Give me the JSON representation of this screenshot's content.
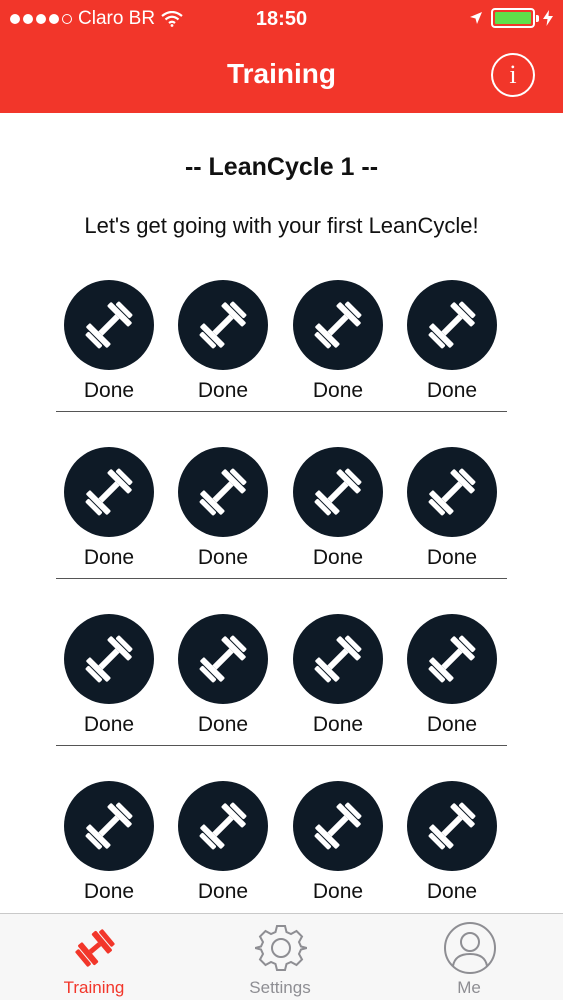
{
  "status_bar": {
    "carrier": "Claro BR",
    "time": "18:50",
    "signal_dots_filled": 4,
    "signal_dots_total": 5,
    "battery_level": 1.0,
    "battery_color": "#5fe04a",
    "icons": [
      "wifi-icon",
      "location-arrow-icon",
      "battery-icon",
      "charging-bolt-icon"
    ]
  },
  "nav": {
    "title": "Training",
    "info_label": "i",
    "background_color": "#f2362a"
  },
  "content": {
    "cycle_title": "-- LeanCycle 1 --",
    "subtitle": "Let's get going with your first LeanCycle!"
  },
  "weeks": [
    {
      "days": [
        {
          "label": "Done",
          "icon": "dumbbell-icon"
        },
        {
          "label": "Done",
          "icon": "dumbbell-icon"
        },
        {
          "label": "Done",
          "icon": "dumbbell-icon"
        },
        {
          "label": "Done",
          "icon": "dumbbell-icon"
        }
      ]
    },
    {
      "days": [
        {
          "label": "Done",
          "icon": "dumbbell-icon"
        },
        {
          "label": "Done",
          "icon": "dumbbell-icon"
        },
        {
          "label": "Done",
          "icon": "dumbbell-icon"
        },
        {
          "label": "Done",
          "icon": "dumbbell-icon"
        }
      ]
    },
    {
      "days": [
        {
          "label": "Done",
          "icon": "dumbbell-icon"
        },
        {
          "label": "Done",
          "icon": "dumbbell-icon"
        },
        {
          "label": "Done",
          "icon": "dumbbell-icon"
        },
        {
          "label": "Done",
          "icon": "dumbbell-icon"
        }
      ]
    },
    {
      "days": [
        {
          "label": "Done",
          "icon": "dumbbell-icon"
        },
        {
          "label": "Done",
          "icon": "dumbbell-icon"
        },
        {
          "label": "Done",
          "icon": "dumbbell-icon"
        },
        {
          "label": "Done",
          "icon": "dumbbell-icon"
        }
      ]
    }
  ],
  "tab_bar": {
    "tabs": [
      {
        "label": "Training",
        "icon": "dumbbell-icon",
        "active": true
      },
      {
        "label": "Settings",
        "icon": "gear-icon",
        "active": false
      },
      {
        "label": "Me",
        "icon": "person-icon",
        "active": false
      }
    ],
    "active_color": "#f2362a",
    "inactive_color": "#8e8e93"
  }
}
